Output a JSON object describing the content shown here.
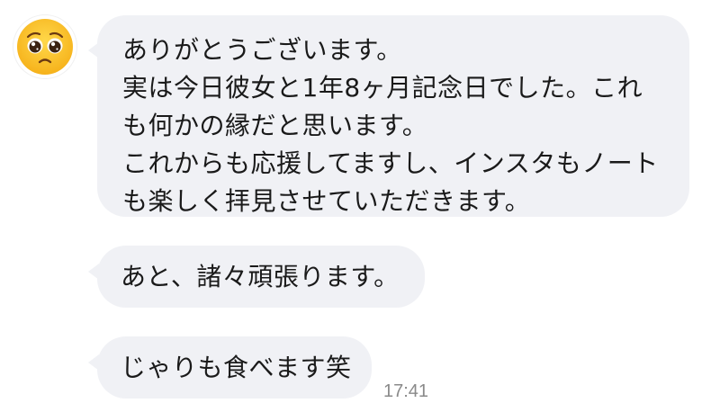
{
  "avatar": {
    "icon": "pleading-face-emoji"
  },
  "messages": [
    {
      "lines": [
        "ありがとうございます。",
        "実は今日彼女と1年8ヶ月記念日でした。これ",
        "も何かの縁だと思います。",
        "これからも応援してますし、インスタもノート",
        "も楽しく拝見させていただきます。"
      ]
    },
    {
      "text": "あと、諸々頑張ります。"
    },
    {
      "text": "じゃりも食べます笑"
    }
  ],
  "timestamp": "17:41",
  "colors": {
    "bubble": "#f0f1f5",
    "text": "#1a1a1a",
    "timestamp": "#8a8a8a"
  }
}
